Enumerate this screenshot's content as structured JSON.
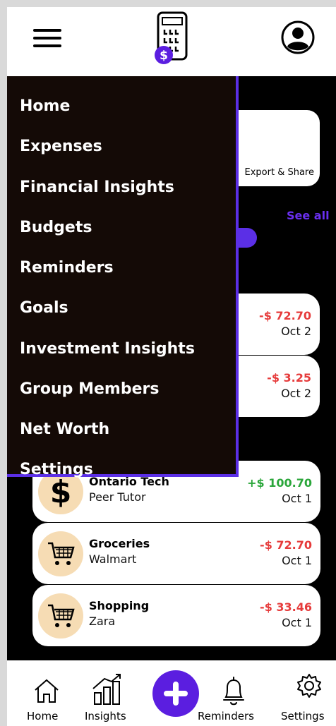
{
  "header": {
    "menu_icon": "hamburger-menu-icon",
    "logo_icon": "calculator-dollar-logo",
    "logo_badge": "$",
    "profile_icon": "user-account-icon"
  },
  "background": {
    "export_label": "Export & Share",
    "see_all": "See all"
  },
  "drawer": {
    "items": [
      {
        "label": "Home"
      },
      {
        "label": "Expenses"
      },
      {
        "label": "Financial Insights"
      },
      {
        "label": "Budgets"
      },
      {
        "label": "Reminders"
      },
      {
        "label": "Goals"
      },
      {
        "label": "Investment Insights"
      },
      {
        "label": "Group Members"
      },
      {
        "label": "Net Worth"
      },
      {
        "label": "Settings"
      }
    ]
  },
  "transactions": {
    "partial": [
      {
        "amount": "-$ 72.70",
        "date": "Oct 2"
      },
      {
        "amount": "-$ 3.25",
        "date": "Oct 2"
      }
    ],
    "full": [
      {
        "icon": "dollar-icon",
        "title": "Ontario Tech",
        "subtitle": "Peer Tutor",
        "amount": "+$ 100.70",
        "date": "Oct 1",
        "type": "positive"
      },
      {
        "icon": "shopping-cart-icon",
        "title": "Groceries",
        "subtitle": "Walmart",
        "amount": "-$ 72.70",
        "date": "Oct 1",
        "type": "negative"
      },
      {
        "icon": "shopping-cart-icon",
        "title": "Shopping",
        "subtitle": "Zara",
        "amount": "-$ 33.46",
        "date": "Oct 1",
        "type": "negative"
      }
    ]
  },
  "bottom_nav": {
    "items": [
      {
        "label": "Home",
        "icon": "home-icon"
      },
      {
        "label": "Insights",
        "icon": "bar-chart-icon"
      },
      {
        "label": "",
        "icon": "plus-icon"
      },
      {
        "label": "Reminders",
        "icon": "bell-icon"
      },
      {
        "label": "Settings",
        "icon": "gear-icon"
      }
    ]
  },
  "colors": {
    "accent": "#5b1ee0",
    "drawer_bg": "#140a06",
    "negative": "#e63b3b",
    "positive": "#2aa63a",
    "icon_bg": "#f6dcb4"
  }
}
